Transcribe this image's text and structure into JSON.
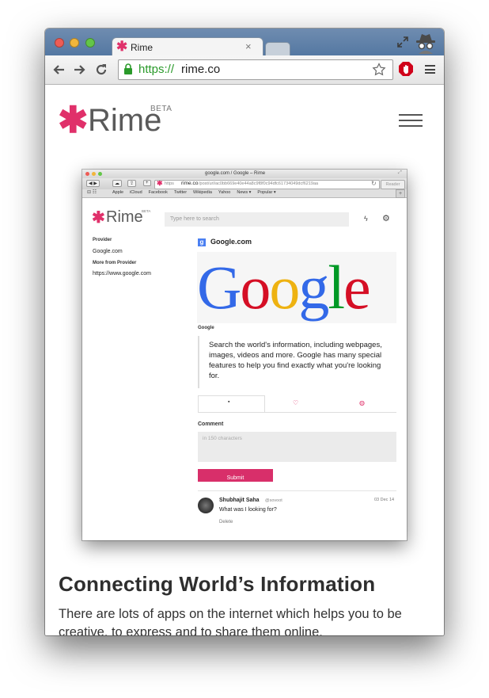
{
  "browser": {
    "tab_title": "Rime",
    "url_scheme": "https://",
    "url_host": "rime.co",
    "icons": [
      "back-icon",
      "forward-icon",
      "reload-icon",
      "lock-icon",
      "star-icon",
      "adblock-icon",
      "menu-icon",
      "incognito-icon",
      "fullscreen-icon"
    ]
  },
  "site": {
    "brand": "Rime",
    "badge": "BETA",
    "accent": "#e0306a"
  },
  "screenshot": {
    "window_title": "google.com / Google – Rime",
    "url_prefix": "https",
    "url_host": "rime.co",
    "url_path": "/post/url/ac0bb669e40e44a8c9f8f0c94dfc61734049dcf6219aa",
    "reader": "Reader",
    "bookmarks": [
      "Apple",
      "iCloud",
      "Facebook",
      "Twitter",
      "Wikipedia",
      "Yahoo",
      "News ▾",
      "Popular ▾"
    ],
    "brand": "Rime",
    "badge": "BETA",
    "search_placeholder": "Type here to search",
    "sidebar": {
      "provider_label": "Provider",
      "provider_value": "Google.com",
      "more_label": "More from Provider",
      "more_value": "https://www.google.com"
    },
    "source_title": "Google.com",
    "logo_text": "Google",
    "caption": "Google",
    "description": "Search the world's information, including webpages, images, videos and more. Google has many special features to help you find exactly what you're looking for.",
    "comment_label": "Comment",
    "comment_placeholder": "in 150 characters",
    "submit_label": "Submit",
    "comment": {
      "author": "Shubhajit Saha",
      "handle": "@sovoot",
      "date": "03 Dec 14",
      "text": "What was I looking for?",
      "delete_label": "Delete"
    }
  },
  "article": {
    "headline": "Connecting World’s Information",
    "body": "There are lots of apps on the internet which helps you to be creative, to express and to share them online."
  }
}
